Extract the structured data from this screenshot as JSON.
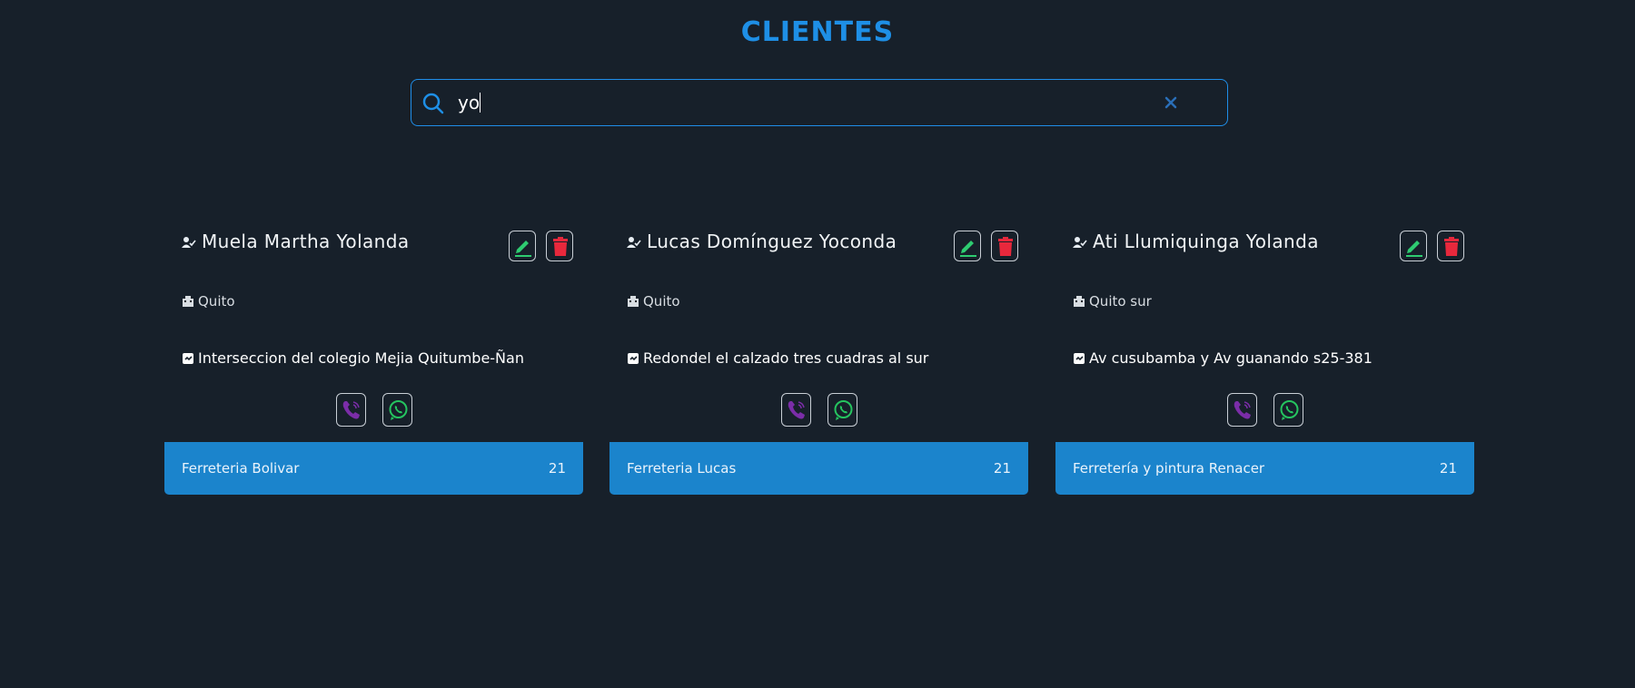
{
  "page": {
    "title": "CLIENTES",
    "accent_color": "#1e8fe6",
    "background_color": "#17202a",
    "footer_color": "#1b84cc"
  },
  "search": {
    "value": "yo",
    "icon": "search-icon",
    "clear_icon": "clear-icon"
  },
  "clients": [
    {
      "name": "Muela Martha Yolanda",
      "city": "Quito",
      "address": "Interseccion del colegio Mejia Quitumbe-Ñan",
      "company": "Ferreteria Bolivar",
      "count": "21"
    },
    {
      "name": "Lucas Domínguez Yoconda",
      "city": "Quito",
      "address": "Redondel el calzado tres cuadras al sur",
      "company": "Ferreteria Lucas",
      "count": "21"
    },
    {
      "name": "Ati Llumiquinga Yolanda",
      "city": "Quito sur",
      "address": "Av cusubamba y Av guanando s25-381",
      "company": "Ferretería y pintura Renacer",
      "count": "21"
    }
  ],
  "icons": {
    "user": "user-icon",
    "city": "building-icon",
    "address": "address-icon",
    "edit": "pencil-icon",
    "delete": "trash-icon",
    "call": "phone-icon",
    "whatsapp": "whatsapp-icon"
  },
  "colors": {
    "edit": "#2ecc71",
    "delete": "#e8283c",
    "call": "#7b2da8",
    "whatsapp": "#25c45f"
  }
}
